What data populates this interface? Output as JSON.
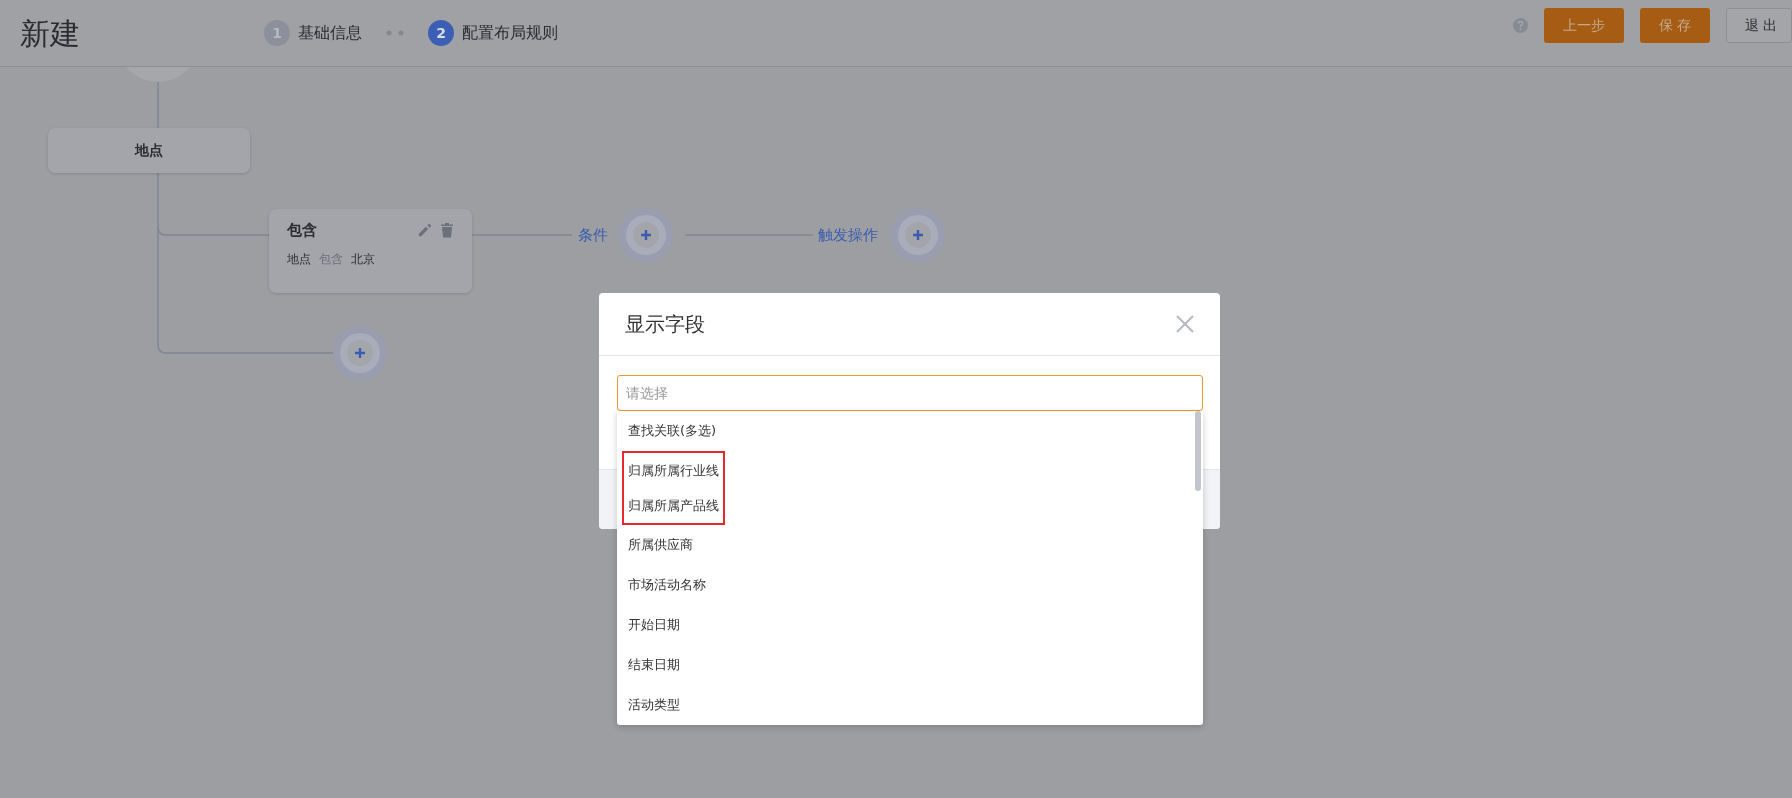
{
  "header": {
    "title": "新建",
    "steps": [
      {
        "number": "1",
        "label": "基础信息",
        "selected": false
      },
      {
        "number": "2",
        "label": "配置布局规则",
        "selected": true
      }
    ],
    "buttons": [
      {
        "label": "上一步",
        "kind": "primary"
      },
      {
        "label": "保 存",
        "kind": "primary"
      },
      {
        "label": "退 出",
        "kind": "default"
      }
    ]
  },
  "flow": {
    "group_node": {
      "label": "地点"
    },
    "rule_card": {
      "title": "包含",
      "field": "地点",
      "operator": "包含",
      "value": "北京"
    },
    "condition_label": "条件",
    "action_label": "触发操作"
  },
  "modal": {
    "title": "显示字段",
    "search": {
      "placeholder": "请选择"
    },
    "options": [
      {
        "label": "查找关联(多选)",
        "highlighted": false
      },
      {
        "label": "归属所属行业线",
        "highlighted": true
      },
      {
        "label": "归属所属产品线",
        "highlighted": true
      },
      {
        "label": "所属供应商",
        "highlighted": false
      },
      {
        "label": "市场活动名称",
        "highlighted": false
      },
      {
        "label": "开始日期",
        "highlighted": false
      },
      {
        "label": "结束日期",
        "highlighted": false
      },
      {
        "label": "活动类型",
        "highlighted": false
      }
    ]
  }
}
